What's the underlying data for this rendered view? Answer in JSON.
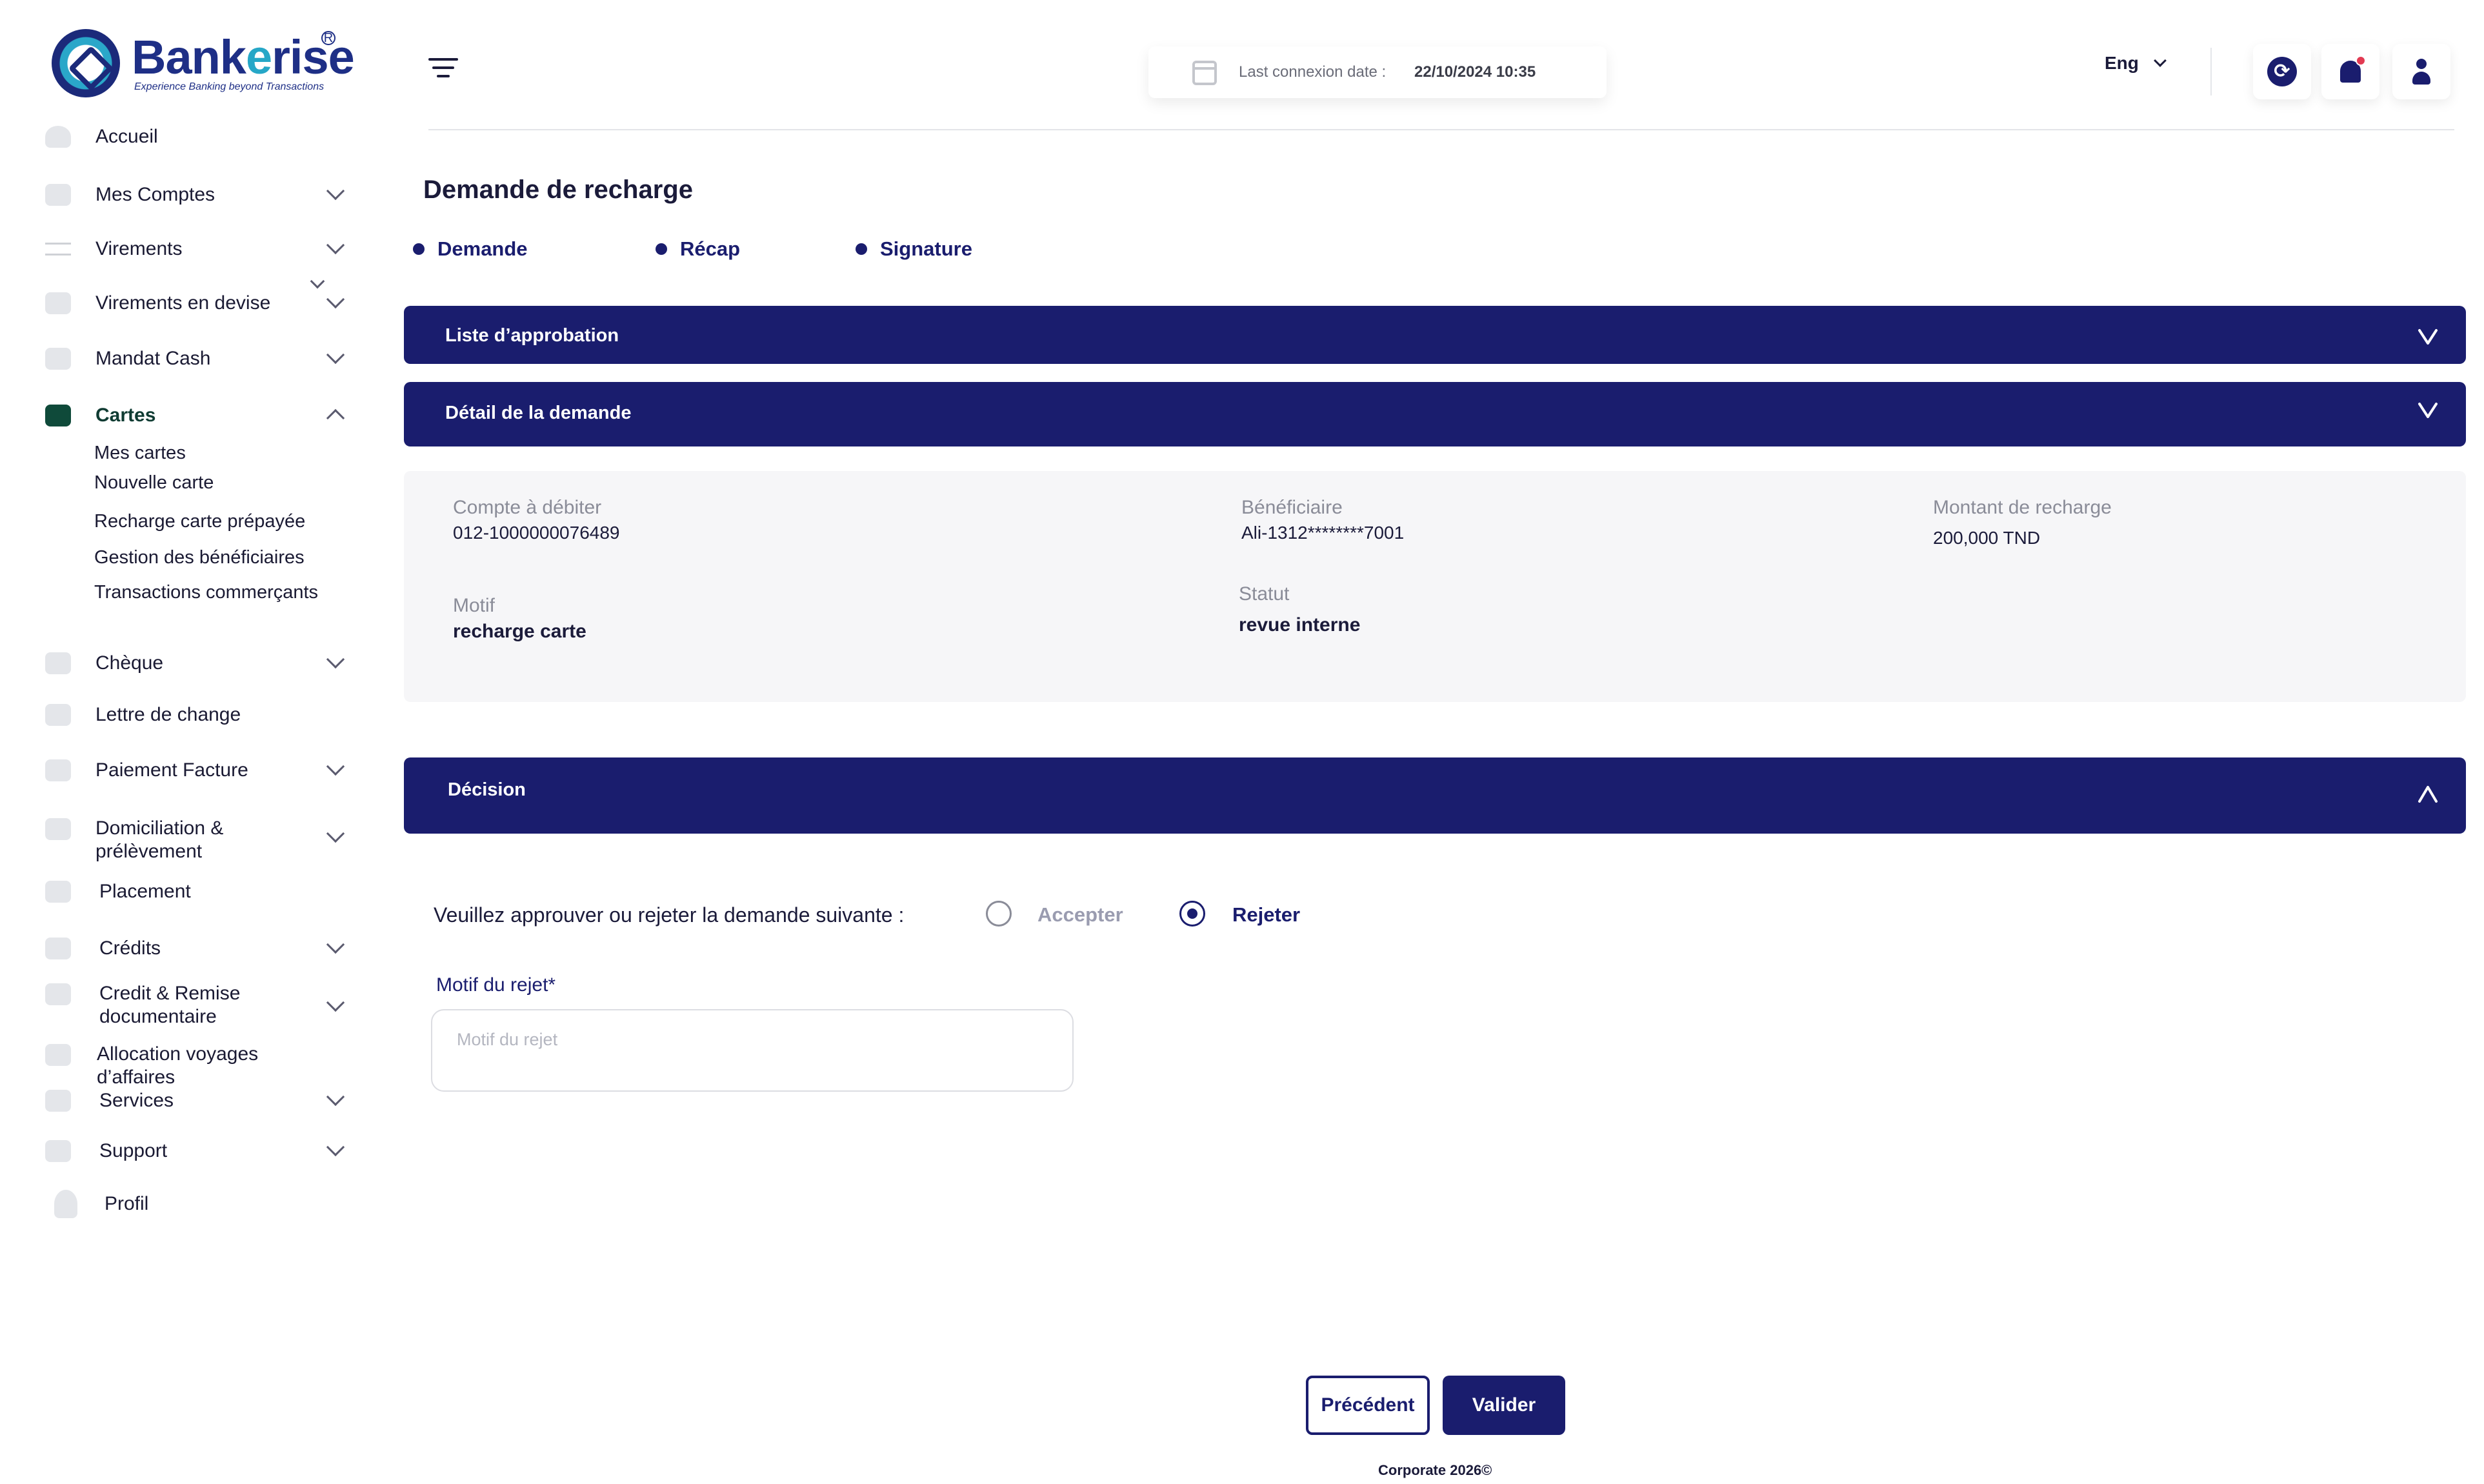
{
  "brand": {
    "name_part1": "Bank",
    "name_part2": "e",
    "name_part3": "rise",
    "tagline": "Experience Banking beyond Transactions",
    "accent": "#1a1d6e",
    "logo_cyan": "#26a7c7"
  },
  "sidebar": {
    "items": [
      {
        "label": "Accueil",
        "icon": "home-icon"
      },
      {
        "label": "Mes Comptes",
        "icon": "folder-icon"
      },
      {
        "label": "Virements",
        "icon": "transfer-icon"
      },
      {
        "label": "Virements en devise",
        "icon": "currency-icon"
      },
      {
        "label": "Mandat Cash",
        "icon": "envelope-icon"
      },
      {
        "label": "Cartes",
        "icon": "card-icon"
      },
      {
        "label": "Chèque",
        "icon": "cheque-icon"
      },
      {
        "label": "Lettre de change",
        "icon": "envelope-icon"
      },
      {
        "label": "Paiement Facture",
        "icon": "invoice-icon"
      },
      {
        "label": "Domiciliation &",
        "label2": "prélèvement",
        "icon": "envelope-icon"
      },
      {
        "label": "Placement",
        "icon": "chart-icon"
      },
      {
        "label": "Crédits",
        "icon": "envelope-icon"
      },
      {
        "label": "Credit & Remise",
        "label2": "documentaire",
        "icon": "envelope-icon"
      },
      {
        "label": "Allocation  voyages",
        "label2": "d’affaires",
        "icon": "envelope-icon"
      },
      {
        "label": "Services",
        "icon": "envelope-icon"
      },
      {
        "label": "Support",
        "icon": "support-icon"
      },
      {
        "label": "Profil",
        "icon": "user-icon"
      }
    ],
    "cartes_sub": [
      "Mes cartes",
      "Nouvelle carte",
      "Recharge carte prépayée",
      "Gestion des bénéficiaires",
      "Transactions commerçants"
    ]
  },
  "header": {
    "last_connexion_label": "Last connexion date :",
    "last_connexion_value": "22/10/2024 10:35",
    "language": "Eng",
    "notification_dot_color": "#e23a52"
  },
  "main": {
    "title": "Demande de recharge",
    "steps": [
      "Demande",
      "Récap",
      "Signature"
    ],
    "approval_list_label": "Liste d’approbation",
    "detail_label": "Détail de la demande",
    "details": {
      "compte_label": "Compte à débiter",
      "compte_value": "012-1000000076489",
      "beneficiaire_label": "Bénéficiaire",
      "beneficiaire_value": "Ali-1312********7001",
      "montant_label": "Montant de recharge",
      "montant_value": "200,000",
      "montant_currency": "TND",
      "motif_label": "Motif",
      "motif_value": "recharge carte",
      "statut_label": "Statut",
      "statut_value": "revue interne"
    },
    "decision_label": "Décision",
    "decision": {
      "prompt": "Veuillez approuver ou rejeter la demande suivante :",
      "accept_label": "Accepter",
      "reject_label": "Rejeter",
      "selected": "Rejeter",
      "reject_reason_label": "Motif du rejet*",
      "reject_reason_placeholder": "Motif du rejet",
      "reject_reason_value": ""
    },
    "buttons": {
      "previous": "Précédent",
      "validate": "Valider"
    },
    "footer": "Corporate 2026©"
  }
}
